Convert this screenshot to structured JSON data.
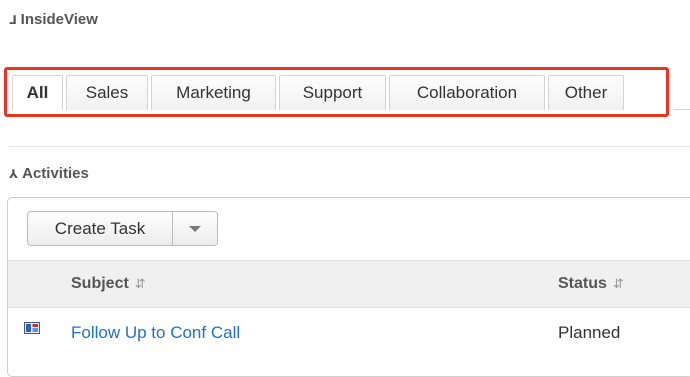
{
  "insideview": {
    "title": "InsideView",
    "collapse_icon": "chevron-double-down-icon"
  },
  "tabs": [
    {
      "label": "All",
      "active": true
    },
    {
      "label": "Sales",
      "active": false
    },
    {
      "label": "Marketing",
      "active": false
    },
    {
      "label": "Support",
      "active": false
    },
    {
      "label": "Collaboration",
      "active": false
    },
    {
      "label": "Other",
      "active": false
    }
  ],
  "highlight_color": "#e8351f",
  "activities": {
    "title": "Activities",
    "collapse_icon": "chevron-double-up-icon",
    "create_button_label": "Create Task",
    "dropdown_icon": "caret-down-icon",
    "columns": [
      {
        "label": "Subject",
        "sort_icon": "sort-icon"
      },
      {
        "label": "Status",
        "sort_icon": "sort-icon"
      }
    ],
    "rows": [
      {
        "type_icon": "task-icon",
        "subject": "Follow Up to Conf Call",
        "status": "Planned"
      }
    ]
  },
  "link_color": "#1e72c8"
}
